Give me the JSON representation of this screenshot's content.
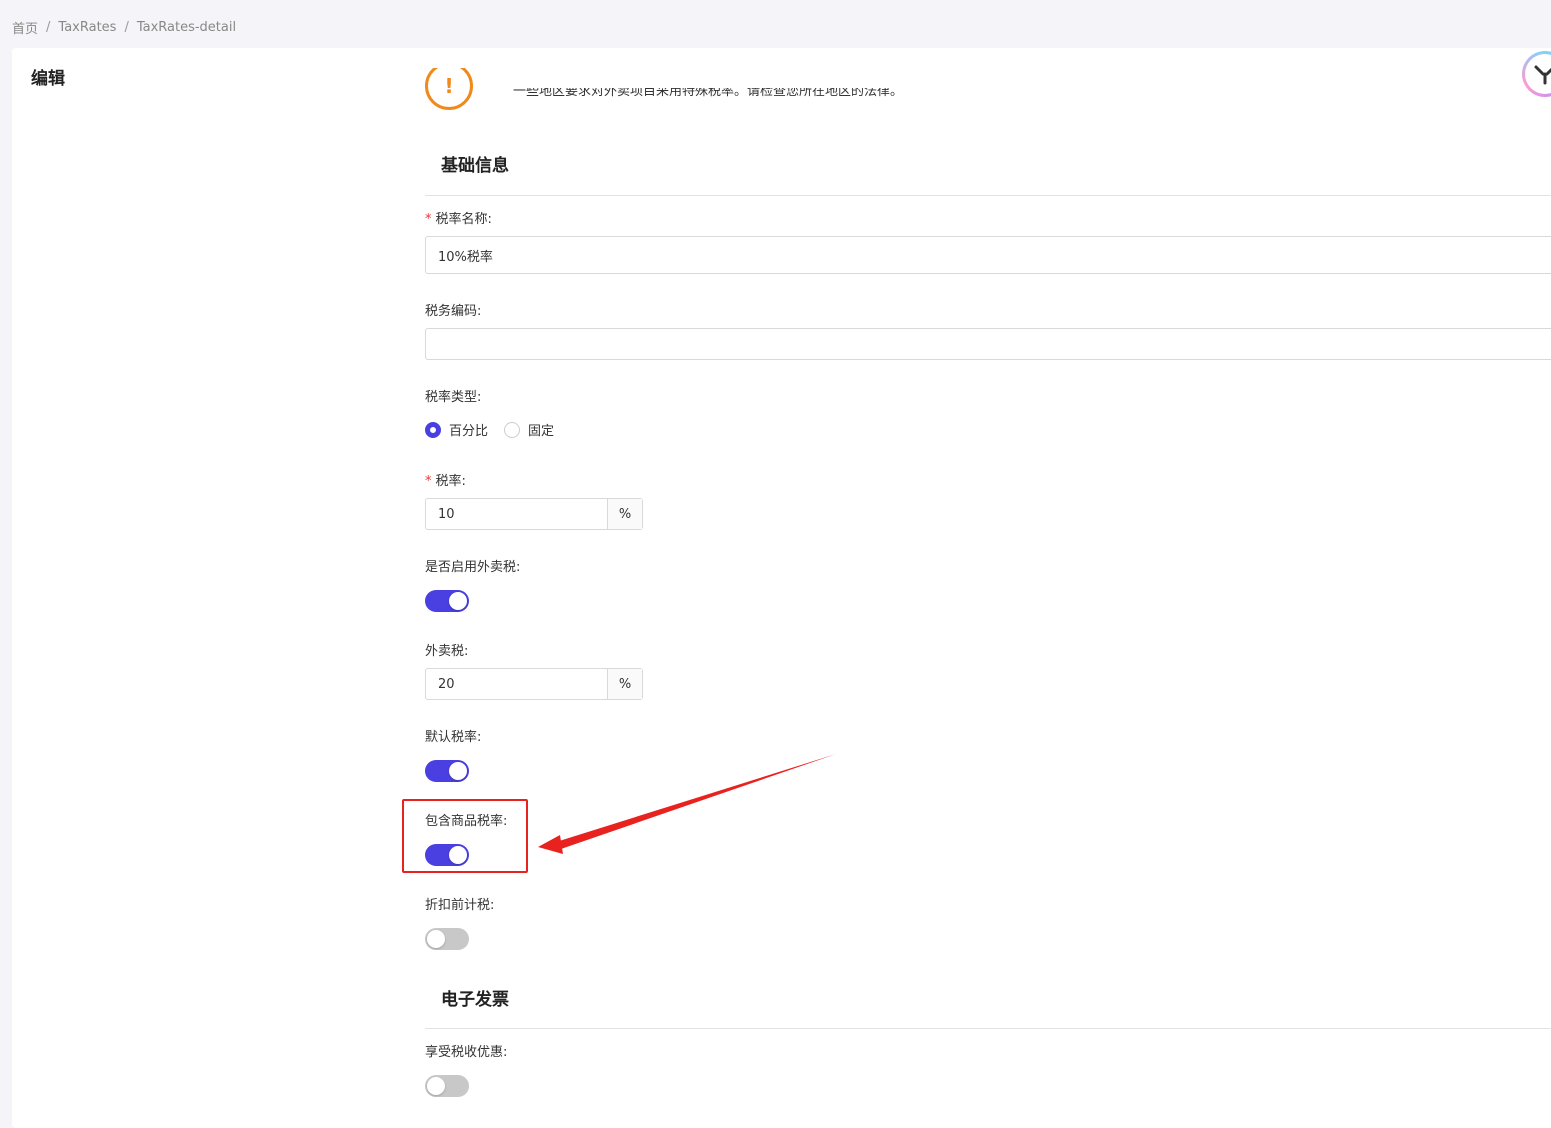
{
  "breadcrumb": {
    "home": "首页",
    "level1": "TaxRates",
    "level2": "TaxRates-detail",
    "separator": "/"
  },
  "card": {
    "title": "编辑"
  },
  "warning": {
    "icon": "warning-icon",
    "text": "一些地区要求对外卖项目采用特殊税率。请检查您所在地区的法律。"
  },
  "sections": {
    "basic": "基础信息",
    "einvoice": "电子发票"
  },
  "fields": {
    "tax_name": {
      "label": "税率名称:",
      "required": true,
      "value": "10%税率"
    },
    "tax_code": {
      "label": "税务编码:",
      "value": ""
    },
    "rate_type": {
      "label": "税率类型:",
      "options": [
        "百分比",
        "固定"
      ],
      "selected": "百分比"
    },
    "rate": {
      "label": "税率:",
      "required": true,
      "value": "10",
      "unit": "%"
    },
    "enable_takeaway": {
      "label": "是否启用外卖税:",
      "on": true
    },
    "takeaway_tax": {
      "label": "外卖税:",
      "value": "20",
      "unit": "%"
    },
    "default_rate": {
      "label": "默认税率:",
      "on": true
    },
    "include_goods_rate": {
      "label": "包含商品税率:",
      "on": true
    },
    "pre_discount": {
      "label": "折扣前计税:",
      "on": false
    },
    "tax_benefit": {
      "label": "享受税收优惠:",
      "on": false
    }
  },
  "colors": {
    "primary": "#4a3fe0",
    "warning": "#f08a1a",
    "annotation": "#e8221f",
    "required": "#e33333"
  }
}
